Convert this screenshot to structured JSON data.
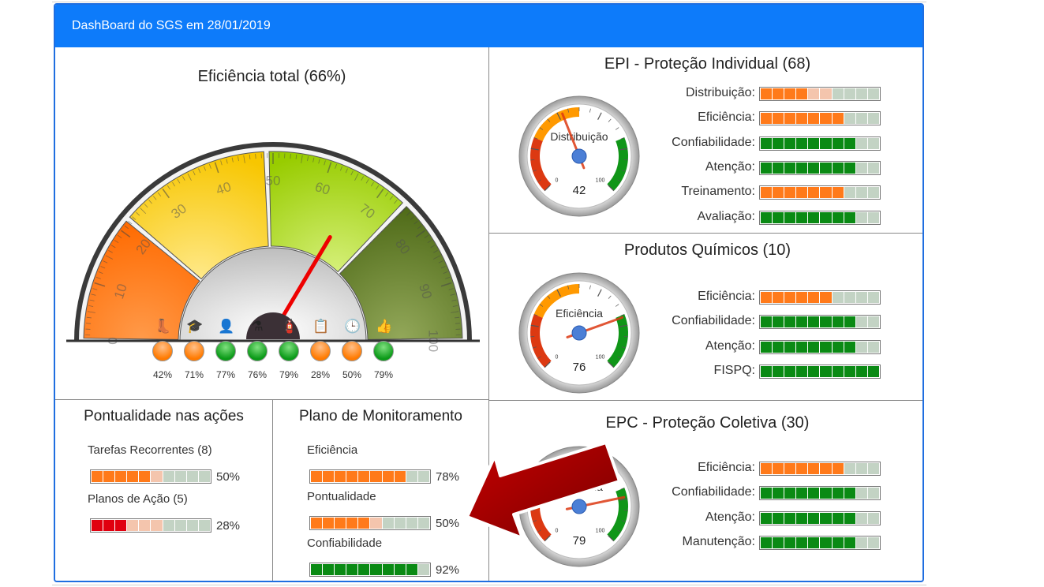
{
  "header": {
    "title": "DashBoard do SGS em 28/01/2019"
  },
  "total": {
    "title": "Eficiência total (66%)",
    "value": 66,
    "ticks": [
      "0",
      "10",
      "20",
      "30",
      "40",
      "50",
      "60",
      "70",
      "80",
      "90",
      "100"
    ],
    "indicators": [
      {
        "icon": "boot-icon",
        "glyph": "👢",
        "value": 42,
        "label": "42%",
        "status": "orange"
      },
      {
        "icon": "graduation-cap-icon",
        "glyph": "🎓",
        "value": 71,
        "label": "71%",
        "status": "orange"
      },
      {
        "icon": "user-check-icon",
        "glyph": "👤",
        "value": 77,
        "label": "77%",
        "status": "green"
      },
      {
        "icon": "flask-icon",
        "glyph": "⚗",
        "value": 76,
        "label": "76%",
        "status": "green"
      },
      {
        "icon": "fire-extinguisher-icon",
        "glyph": "🧯",
        "value": 79,
        "label": "79%",
        "status": "green"
      },
      {
        "icon": "clipboard-check-icon",
        "glyph": "📋",
        "value": 28,
        "label": "28%",
        "status": "orange"
      },
      {
        "icon": "clock-icon",
        "glyph": "🕒",
        "value": 50,
        "label": "50%",
        "status": "orange"
      },
      {
        "icon": "thumbs-up-icon",
        "glyph": "👍",
        "value": 79,
        "label": "79%",
        "status": "green"
      }
    ]
  },
  "epi": {
    "title": "EPI - Proteção Individual (68)",
    "gauge": {
      "label": "Distribuição",
      "value": 42,
      "display": "42",
      "min_label": "0",
      "max_label": "100"
    },
    "bars": [
      {
        "label": "Distribuição:",
        "value": 40,
        "color": "orange"
      },
      {
        "label": "Eficiência:",
        "value": 70,
        "color": "orange"
      },
      {
        "label": "Confiabilidade:",
        "value": 80,
        "color": "green"
      },
      {
        "label": "Atenção:",
        "value": 80,
        "color": "green"
      },
      {
        "label": "Treinamento:",
        "value": 70,
        "color": "orange"
      },
      {
        "label": "Avaliação:",
        "value": 80,
        "color": "green"
      }
    ]
  },
  "quimicos": {
    "title": "Produtos Químicos (10)",
    "gauge": {
      "label": "Eficiência",
      "value": 76,
      "display": "76",
      "min_label": "0",
      "max_label": "100"
    },
    "bars": [
      {
        "label": "Eficiência:",
        "value": 60,
        "color": "orange"
      },
      {
        "label": "Confiabilidade:",
        "value": 80,
        "color": "green"
      },
      {
        "label": "Atenção:",
        "value": 80,
        "color": "green"
      },
      {
        "label": "FISPQ:",
        "value": 100,
        "color": "green"
      }
    ]
  },
  "epc": {
    "title": "EPC - Proteção Coletiva (30)",
    "gauge": {
      "label": "Eficiência",
      "value": 79,
      "display": "79",
      "min_label": "0",
      "max_label": "100"
    },
    "bars": [
      {
        "label": "Eficiência:",
        "value": 70,
        "color": "orange"
      },
      {
        "label": "Confiabilidade:",
        "value": 80,
        "color": "green"
      },
      {
        "label": "Atenção:",
        "value": 80,
        "color": "green"
      },
      {
        "label": "Manutenção:",
        "value": 80,
        "color": "green"
      }
    ]
  },
  "pontualidade": {
    "title": "Pontualidade nas ações",
    "items": [
      {
        "label": "Tarefas Recorrentes (8)",
        "value": 50,
        "pct": "50%",
        "color": "orange"
      },
      {
        "label": "Planos de Ação (5)",
        "value": 28,
        "pct": "28%",
        "color": "red"
      }
    ]
  },
  "monitoramento": {
    "title": "Plano de Monitoramento",
    "items": [
      {
        "label": "Eficiência",
        "value": 78,
        "pct": "78%",
        "color": "orange"
      },
      {
        "label": "Pontualidade",
        "value": 50,
        "pct": "50%",
        "color": "orange"
      },
      {
        "label": "Confiabilidade",
        "value": 92,
        "pct": "92%",
        "color": "green"
      }
    ]
  },
  "colors": {
    "orange": "#ff7a1a",
    "orange_light": "#f4c5ad",
    "green": "#0a8a14",
    "green_light": "#c3d3c4",
    "red": "#e0000f",
    "header_blue": "#0d7bfa",
    "arrow": "#b00000"
  }
}
